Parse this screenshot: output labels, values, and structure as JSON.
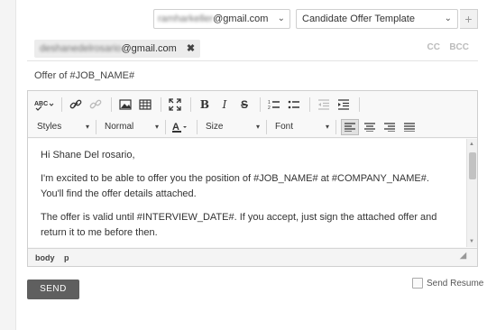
{
  "compose": {
    "from_email_blurred": "ramharkeller",
    "from_email_domain": "@gmail.com",
    "template_select": "Candidate Offer Template",
    "add_label": "+",
    "to_blurred": "deshanedelrosario",
    "to_domain": "@gmail.com",
    "remove_label": "✖",
    "cc": "CC",
    "bcc": "BCC",
    "subject": "Offer of #JOB_NAME#"
  },
  "toolbar": {
    "styles": "Styles",
    "format": "Normal",
    "size": "Size",
    "font": "Font"
  },
  "body": {
    "greeting": "Hi Shane Del rosario,",
    "paragraph1": "I'm excited to be able to offer you the position of #JOB_NAME# at #COMPANY_NAME#. You'll find the offer details attached.",
    "paragraph2": "The offer is valid until #INTERVIEW_DATE#. If you accept, just sign the attached offer and return it to me before then."
  },
  "status_path": [
    "body",
    "p"
  ],
  "footer": {
    "send_label": "SEND",
    "send_resume_label": "Send Resume"
  }
}
